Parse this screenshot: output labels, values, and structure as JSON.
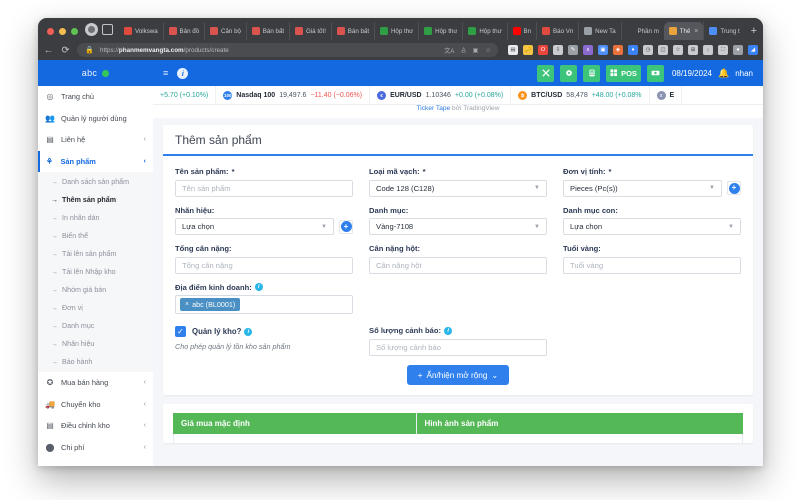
{
  "browser": {
    "tabs": [
      {
        "label": "Volkswa",
        "color": "#e04a3f",
        "active": false
      },
      {
        "label": "Bản đồ",
        "color": "#d9534f",
        "active": false
      },
      {
        "label": "Căn bộ",
        "color": "#d9534f",
        "active": false
      },
      {
        "label": "Bán bất",
        "color": "#d9534f",
        "active": false
      },
      {
        "label": "Giá tốt!",
        "color": "#d9534f",
        "active": false
      },
      {
        "label": "Bán bất",
        "color": "#d9534f",
        "active": false
      },
      {
        "label": "Hộp thư",
        "color": "#2f9e44",
        "active": false
      },
      {
        "label": "Hộp thư",
        "color": "#2f9e44",
        "active": false
      },
      {
        "label": "Hộp thư",
        "color": "#2f9e44",
        "active": false
      },
      {
        "label": "Bn",
        "color": "#ff0000",
        "active": false
      },
      {
        "label": "Báo Vn",
        "color": "#e04a3f",
        "active": false
      },
      {
        "label": "New Ta",
        "color": "#9aa0a6",
        "active": false
      },
      {
        "label": "Phần m",
        "color": "#3b3d41",
        "active": false
      },
      {
        "label": "Thê",
        "color": "#e8a33d",
        "active": true
      },
      {
        "label": "Trung t",
        "color": "#4e8ef7",
        "active": false
      }
    ],
    "newtab_label": "+",
    "nav": {
      "back_icon": "arrow-left-icon",
      "reload_icon": "reload-icon",
      "lock_icon": "lock-icon",
      "url_prefix": "https://",
      "url_domain": "phanmemvangta.com",
      "url_path": "/products/create",
      "omni_actions": [
        "A",
        "translate",
        "star"
      ]
    },
    "extensions": [
      {
        "name": "wallet-extension",
        "color": "#e8eaed",
        "glyph": "▤"
      },
      {
        "name": "key-extension",
        "color": "#f6c445",
        "glyph": "🔑"
      },
      {
        "name": "opera-extension",
        "color": "#e8453c",
        "glyph": "O"
      },
      {
        "name": "download-extension",
        "color": "#c9cbce",
        "glyph": "⇩"
      },
      {
        "name": "pen-extension",
        "color": "#9aa0a6",
        "glyph": "✎"
      },
      {
        "name": "brave-extension",
        "color": "#8b6ad0",
        "glyph": "∧"
      },
      {
        "name": "drive-extension",
        "color": "#4e8ef7",
        "glyph": "▣"
      },
      {
        "name": "firefox-extension",
        "color": "#e8703a",
        "glyph": "◈"
      },
      {
        "name": "bluetooth-extension",
        "color": "#3b82f6",
        "glyph": "♦"
      },
      {
        "name": "clock-extension",
        "color": "#c9cbce",
        "glyph": "◷"
      },
      {
        "name": "split-extension",
        "color": "#c9cbce",
        "glyph": "◫"
      },
      {
        "name": "star-extension",
        "color": "#c9cbce",
        "glyph": "☆"
      },
      {
        "name": "collections-extension",
        "color": "#c9cbce",
        "glyph": "⊞"
      },
      {
        "name": "history-extension",
        "color": "#c9cbce",
        "glyph": "↓"
      },
      {
        "name": "screenshot-extension",
        "color": "#c9cbce",
        "glyph": "⛶"
      },
      {
        "name": "profile-extension",
        "color": "#9aa0a6",
        "glyph": "●"
      },
      {
        "name": "edge-extension",
        "color": "#3b82f6",
        "glyph": "◢"
      }
    ]
  },
  "appbar": {
    "brand": "abc",
    "menu_icon": "hamburger-icon",
    "info_icon": "info-icon",
    "buttons": [
      {
        "name": "fullscreen-button",
        "label": "",
        "icon": "expand-icon"
      },
      {
        "name": "settings-button",
        "label": "",
        "icon": "gear-icon"
      },
      {
        "name": "calculator-button",
        "label": "",
        "icon": "calculator-icon"
      },
      {
        "name": "pos-button",
        "label": "POS",
        "icon": "grid-icon"
      },
      {
        "name": "cash-button",
        "label": "",
        "icon": "cash-icon"
      }
    ],
    "date": "08/19/2024",
    "bell_icon": "bell-icon",
    "username": "nhan",
    "accent": "#1569e0",
    "button_green": "#3bc47a"
  },
  "sidebar": {
    "items": [
      {
        "label": "Trang chủ",
        "icon": "dashboard-icon",
        "chevron": false,
        "active": false
      },
      {
        "label": "Quản lý người dùng",
        "icon": "users-icon",
        "chevron": false,
        "active": false
      },
      {
        "label": "Liên hệ",
        "icon": "contact-icon",
        "chevron": true,
        "active": false
      },
      {
        "label": "Sản phẩm",
        "icon": "product-icon",
        "chevron": true,
        "active": true
      }
    ],
    "sub_items": [
      {
        "label": "Danh sách sản phẩm",
        "current": false
      },
      {
        "label": "Thêm sản phẩm",
        "current": true
      },
      {
        "label": "In nhãn dán",
        "current": false
      },
      {
        "label": "Biến thể",
        "current": false
      },
      {
        "label": "Tải lên sản phẩm",
        "current": false
      },
      {
        "label": "Tải lên Nhập kho",
        "current": false
      },
      {
        "label": "Nhóm giá bán",
        "current": false
      },
      {
        "label": "Đơn vị",
        "current": false
      },
      {
        "label": "Danh mục",
        "current": false
      },
      {
        "label": "Nhãn hiệu",
        "current": false
      },
      {
        "label": "Bảo hành",
        "current": false
      }
    ],
    "items_after": [
      {
        "label": "Mua bán hàng",
        "icon": "cart-icon",
        "chevron": true,
        "active": false
      },
      {
        "label": "Chuyển kho",
        "icon": "truck-icon",
        "chevron": true,
        "active": false
      },
      {
        "label": "Điều chỉnh kho",
        "icon": "stack-icon",
        "chevron": true,
        "active": false
      },
      {
        "label": "Chi phí",
        "icon": "coin-icon",
        "chevron": true,
        "active": false
      }
    ]
  },
  "ticker": {
    "items": [
      {
        "symbol": "",
        "badge": "",
        "badge_color": "",
        "price": "",
        "change": "+5.70 (+0.10%)",
        "dir": "up"
      },
      {
        "symbol": "Nasdaq 100",
        "badge": "100",
        "badge_color": "#2f80ed",
        "price": "19,497.6",
        "change": "−11.40 (−0.06%)",
        "dir": "down"
      },
      {
        "symbol": "EUR/USD",
        "badge": "€",
        "badge_color": "#4b6bdd",
        "price": "1.10346",
        "change": "+0.00 (+0.08%)",
        "dir": "up"
      },
      {
        "symbol": "BTC/USD",
        "badge": "₿",
        "badge_color": "#f7931a",
        "price": "58,478",
        "change": "+48.00 (+0.08%",
        "dir": "up"
      },
      {
        "symbol": "E",
        "badge": "Ξ",
        "badge_color": "#8a92b2",
        "price": "",
        "change": "",
        "dir": "up"
      }
    ],
    "caption_link": "Ticker Tape",
    "caption_rest": " bởi TradingView"
  },
  "page": {
    "title": "Thêm sản phẩm"
  },
  "form": {
    "product_name": {
      "label": "Tên sản phẩm:",
      "required": "*",
      "placeholder": "Tên sản phẩm",
      "value": ""
    },
    "barcode_type": {
      "label": "Loại mã vạch:",
      "required": "*",
      "value": "Code 128 (C128)"
    },
    "unit": {
      "label": "Đơn vị tính:",
      "required": "*",
      "value": "Pieces (Pc(s))",
      "has_add": true
    },
    "brand": {
      "label": "Nhãn hiệu:",
      "required": "",
      "value": "Lựa chọn",
      "has_add": true
    },
    "category": {
      "label": "Danh mục:",
      "required": "",
      "value": "Vàng-7108"
    },
    "subcategory": {
      "label": "Danh mục con:",
      "required": "",
      "value": "Lựa chọn"
    },
    "total_weight": {
      "label": "Tổng cân nặng:",
      "required": "",
      "placeholder": "Tổng cân nặng",
      "value": ""
    },
    "stone_weight": {
      "label": "Cân nặng hột:",
      "required": "",
      "placeholder": "Cân nặng hột",
      "value": ""
    },
    "gold_age": {
      "label": "Tuổi vàng:",
      "required": "",
      "placeholder": "Tuổi vàng",
      "value": ""
    },
    "business_location": {
      "label": "Địa điểm kinh doanh:",
      "info": true,
      "tag": "abc (BL0001)",
      "tag_remove": "×"
    },
    "alert_qty": {
      "label": "Số lượng cảnh báo:",
      "info": true,
      "placeholder": "Số lượng cảnh báo",
      "value": ""
    },
    "manage_stock": {
      "label": "Quản lý kho?",
      "info": true,
      "checked": true,
      "check_glyph": "✓",
      "hint": "Cho phép quản lý tồn kho sản phẩm"
    },
    "expand_button": {
      "plus": "+",
      "label": "Ẩn/hiện mở rộng",
      "caret": "⌄"
    }
  },
  "table": {
    "headers": [
      "Giá mua mặc định",
      "Hình ảnh sản phẩm"
    ],
    "header_color": "#54b857"
  }
}
